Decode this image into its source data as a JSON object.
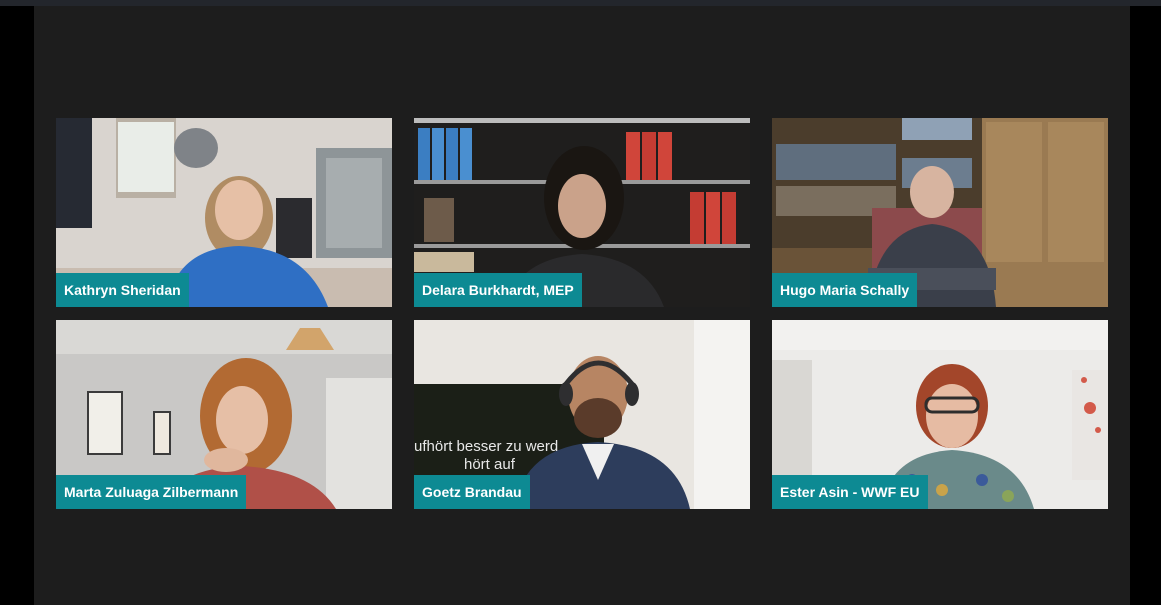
{
  "meeting": {
    "participants": [
      {
        "name": "Kathryn Sheridan"
      },
      {
        "name": "Delara Burkhardt, MEP"
      },
      {
        "name": "Hugo Maria Schally"
      },
      {
        "name": "Marta Zuluaga Zilbermann"
      },
      {
        "name": "Goetz Brandau"
      },
      {
        "name": "Ester Asin - WWF EU"
      }
    ],
    "background_text": {
      "line1": "ufhört besser zu werd",
      "line2": "hört auf"
    }
  },
  "colors": {
    "name_tag": "#0d8a93",
    "stage": "#1d1d1d"
  }
}
